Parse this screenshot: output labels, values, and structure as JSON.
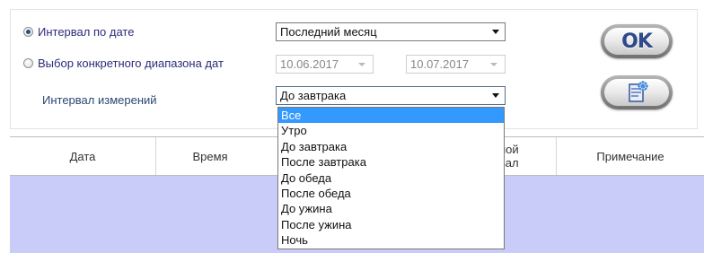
{
  "filters": {
    "date_interval_label": "Интервал по дате",
    "date_interval_selected": true,
    "date_interval_value": "Последний месяц",
    "date_range_label": "Выбор конкретного диапазона дат",
    "date_range_selected": false,
    "date_from": "10.06.2017",
    "date_to": "10.07.2017",
    "measurement_interval_label": "Интервал измерений",
    "measurement_interval_value": "До завтрака",
    "measurement_interval_options": [
      "Все",
      "Утро",
      "До завтрака",
      "После завтрака",
      "До обеда",
      "После обеда",
      "До ужина",
      "После ужина",
      "Ночь"
    ],
    "highlighted_option": "Все"
  },
  "buttons": {
    "ok_label": "OK",
    "export_icon": "document-sparkle-icon"
  },
  "table": {
    "columns": [
      "Дата",
      "Время",
      "",
      "…ной\n…вал",
      "Примечание"
    ],
    "visible_col4_line1": "ной",
    "visible_col4_line2": "вал",
    "rows": []
  },
  "colors": {
    "table_background": "#c9cbf9",
    "highlight": "#3399ff",
    "ok_text": "#2f4a8a",
    "radio_label": "#2c2c7a"
  }
}
